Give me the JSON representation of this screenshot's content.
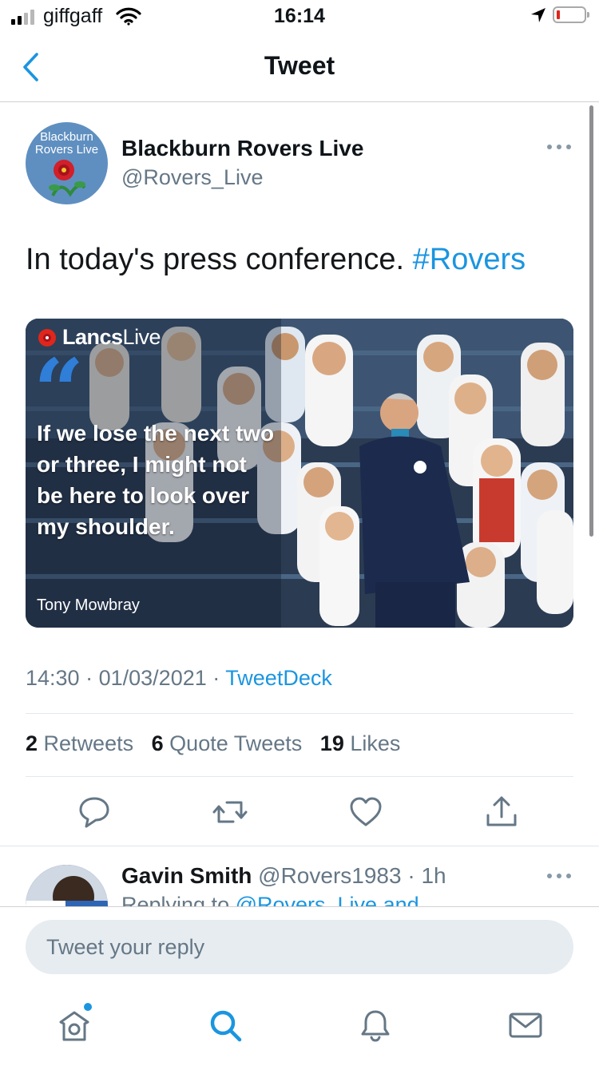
{
  "status_bar": {
    "carrier": "giffgaff",
    "time": "16:14",
    "signal_bars_filled": 2,
    "signal_bars_total": 4,
    "battery_level": "low",
    "colors": {
      "battery_low": "#e0261b"
    }
  },
  "nav": {
    "title": "Tweet",
    "back_icon": "chevron-left-icon"
  },
  "tweet": {
    "author_name": "Blackburn Rovers Live",
    "author_handle": "@Rovers_Live",
    "avatar_text_line1": "Blackburn",
    "avatar_text_line2": "Rovers Live",
    "text": "In today's press conference. ",
    "hashtag": "#Rovers",
    "media": {
      "brand_bold": "Lancs",
      "brand_light": "Live",
      "quote_mark": "“",
      "quote": "If we lose the next two or three, I might not be here to look over my shoulder.",
      "author": "Tony Mowbray"
    },
    "time": "14:30",
    "date": "01/03/2021",
    "separator": "·",
    "source": "TweetDeck",
    "stats": {
      "retweets_count": "2",
      "retweets_label": "Retweets",
      "quotes_count": "6",
      "quotes_label": "Quote Tweets",
      "likes_count": "19",
      "likes_label": "Likes"
    },
    "actions": [
      "reply-icon",
      "retweet-icon",
      "like-icon",
      "share-icon"
    ]
  },
  "reply": {
    "name": "Gavin Smith",
    "handle": "@Rovers1983",
    "separator": "·",
    "age": "1h",
    "preview_prefix": "Replying to ",
    "preview_mention": "@Rovers_Live and"
  },
  "composer": {
    "placeholder": "Tweet your reply"
  },
  "tab_bar": {
    "items": [
      "home-icon",
      "search-icon",
      "notifications-icon",
      "messages-icon"
    ],
    "active": "search-icon"
  },
  "colors": {
    "accent": "#1b95e0",
    "secondary_text": "#657786",
    "primary_text": "#14171a",
    "input_bg": "#e6ecf0"
  }
}
